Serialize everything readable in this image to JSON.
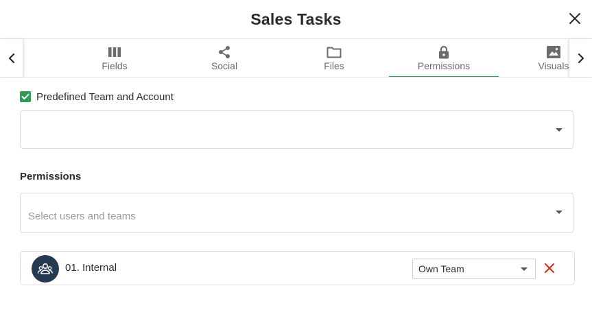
{
  "dialog": {
    "title": "Sales Tasks",
    "close_icon": "close-icon"
  },
  "tabs": [
    {
      "label": "Fields",
      "icon": "columns-icon",
      "active": false
    },
    {
      "label": "Social",
      "icon": "share-icon",
      "active": false
    },
    {
      "label": "Files",
      "icon": "folder-icon",
      "active": false
    },
    {
      "label": "Permissions",
      "icon": "lock-icon",
      "active": true
    },
    {
      "label": "Visuals",
      "icon": "image-icon",
      "active": false
    }
  ],
  "predefined": {
    "label": "Predefined Team and Account",
    "checked": true,
    "selected_value": ""
  },
  "permissions": {
    "title": "Permissions",
    "placeholder": "Select users and teams",
    "entries": [
      {
        "name": "01. Internal",
        "icon": "team-icon",
        "role": "Own Team"
      }
    ]
  },
  "colors": {
    "accent": "#2f9b55",
    "avatar_bg": "#263a52",
    "remove": "#d93025"
  }
}
